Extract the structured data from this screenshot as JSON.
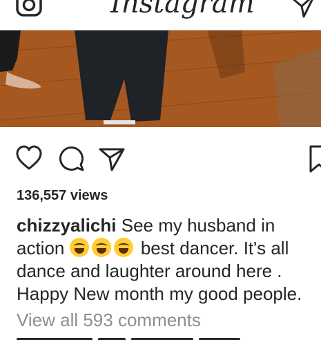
{
  "header": {
    "logo_text": "Instagram",
    "camera_icon": "camera-icon",
    "direct_icon": "paper-plane-icon"
  },
  "post": {
    "actions": {
      "like_icon": "heart-icon",
      "comment_icon": "comment-bubble-icon",
      "share_icon": "paper-plane-icon",
      "save_icon": "bookmark-icon"
    },
    "views": "136,557 views",
    "caption": {
      "username": "chizzyalichi",
      "line1_text": " See my husband in",
      "line2_prefix": "action ",
      "emoji_name": "rolling-on-floor-laughing",
      "line2_suffix": " best dancer. It's all",
      "line3": "dance and laughter around here .",
      "line4": "Happy New month my good people."
    },
    "view_all_comments": "View all 593 comments"
  },
  "colors": {
    "text": "#262626",
    "muted": "#8e8e8e",
    "divider": "#dbdbdb",
    "floor": "#a5581f"
  }
}
